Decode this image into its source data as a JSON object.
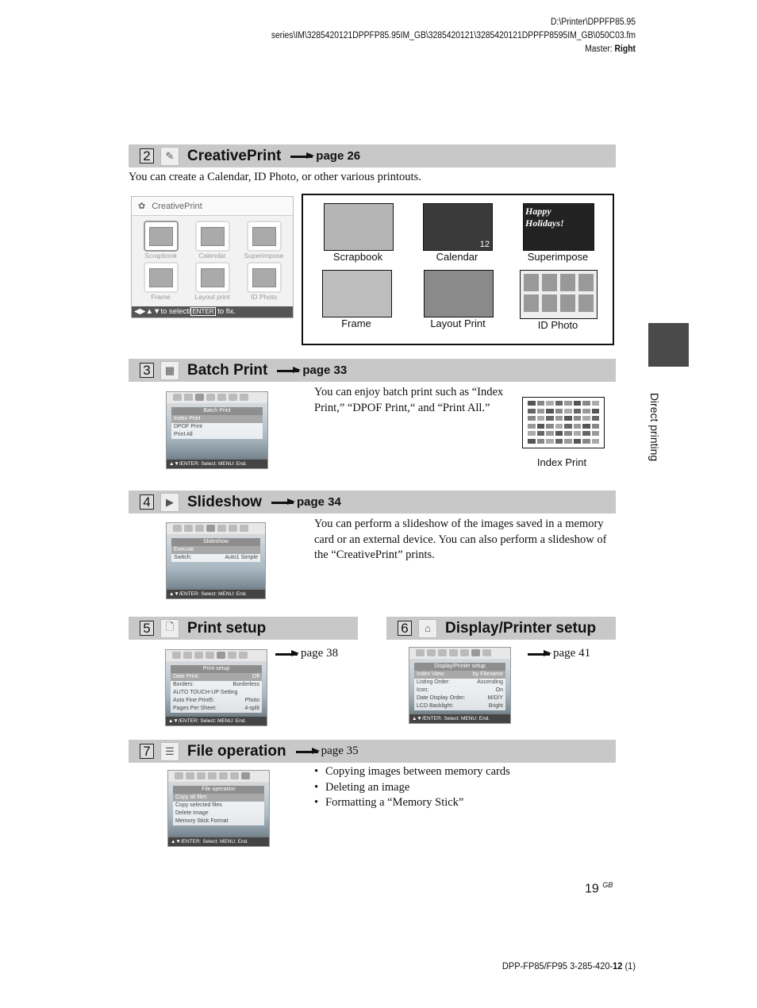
{
  "header": {
    "path": "D:\\Printer\\DPPFP85.95 series\\IM\\3285420121DPPFP85.95IM_GB\\3285420121\\3285420121DPPFP8595IM_GB\\050C03.fm",
    "master_label": "Master: ",
    "master_value": "Right"
  },
  "side_tab": {
    "label": "Direct printing"
  },
  "sections": {
    "creative": {
      "number": "2",
      "title": "CreativePrint",
      "page_ref": "page 26",
      "description": "You can create a Calendar, ID Photo, or other various printouts.",
      "screen": {
        "title": "CreativePrint",
        "items": [
          "Scrapbook",
          "Calendar",
          "Superimpose",
          "Frame",
          "Layout print",
          "ID Photo"
        ],
        "footer_nav": "◀▶▲▼to select/",
        "footer_key": "ENTER",
        "footer_end": " to fix."
      },
      "samples": [
        "Scrapbook",
        "Calendar",
        "Superimpose",
        "Frame",
        "Layout Print",
        "ID Photo"
      ],
      "superimpose_text": "Happy Holidays!",
      "calendar_month": "12"
    },
    "batch": {
      "number": "3",
      "title": "Batch Print",
      "page_ref": "page 33",
      "description": "You can enjoy batch print such as “Index Print,” “DPOF Print,“ and “Print All.”",
      "screen": {
        "title": "Batch Print",
        "items": [
          {
            "label": "Index Print",
            "value": ""
          },
          {
            "label": "DPOF Print",
            "value": ""
          },
          {
            "label": "Print All",
            "value": ""
          }
        ]
      },
      "sample_caption": "Index Print"
    },
    "slideshow": {
      "number": "4",
      "title": "Slideshow",
      "page_ref": "page 34",
      "description": "You can perform a slideshow of the images saved in a memory card or an external device. You can also perform a slideshow of the “CreativePrint” prints.",
      "screen": {
        "title": "Slideshow",
        "items": [
          {
            "label": "Execute",
            "value": ""
          },
          {
            "label": "Switch:",
            "value": "Auto1 Simple"
          }
        ]
      }
    },
    "print_setup": {
      "number": "5",
      "title": "Print setup",
      "page_ref": "page 38",
      "screen": {
        "title": "Print setup",
        "items": [
          {
            "label": "Date Print:",
            "value": "Off"
          },
          {
            "label": "Borders:",
            "value": "Borderless"
          },
          {
            "label": "AUTO TOUCH-UP Setting",
            "value": ""
          },
          {
            "label": "Auto Fine Print5:",
            "value": "Photo"
          },
          {
            "label": "Pages Per Sheet:",
            "value": "4-split"
          }
        ]
      }
    },
    "display_setup": {
      "number": "6",
      "title": "Display/Printer setup",
      "page_ref": "page 41",
      "screen": {
        "title": "Display/Printer setup",
        "items": [
          {
            "label": "Index View:",
            "value": "by Filename"
          },
          {
            "label": "Listing Order:",
            "value": "Ascending"
          },
          {
            "label": "Icon:",
            "value": "On"
          },
          {
            "label": "Date Display Order:",
            "value": "M/D/Y"
          },
          {
            "label": "LCD Backlight:",
            "value": "Bright"
          }
        ]
      }
    },
    "file_op": {
      "number": "7",
      "title": "File operation",
      "page_ref": "page 35",
      "bullets": [
        "Copying images between memory cards",
        "Deleting an image",
        "Formatting a “Memory Stick”"
      ],
      "screen": {
        "title": "File operation",
        "items": [
          {
            "label": "Copy all files",
            "value": ""
          },
          {
            "label": "Copy selected files",
            "value": ""
          },
          {
            "label": "Delete Image",
            "value": ""
          },
          {
            "label": "Memory Stick Format",
            "value": ""
          }
        ]
      }
    }
  },
  "lcd_footer": {
    "nav": "▲▼/",
    "enter": "ENTER",
    "select": ": Select: ",
    "menu": "MENU",
    "end": ": End."
  },
  "footer": {
    "page_number": "19",
    "page_suffix": "GB",
    "doc_code_pre": "DPP-FP85/FP95 3-285-420-",
    "doc_code_bold": "12",
    "doc_code_post": " (1)"
  }
}
